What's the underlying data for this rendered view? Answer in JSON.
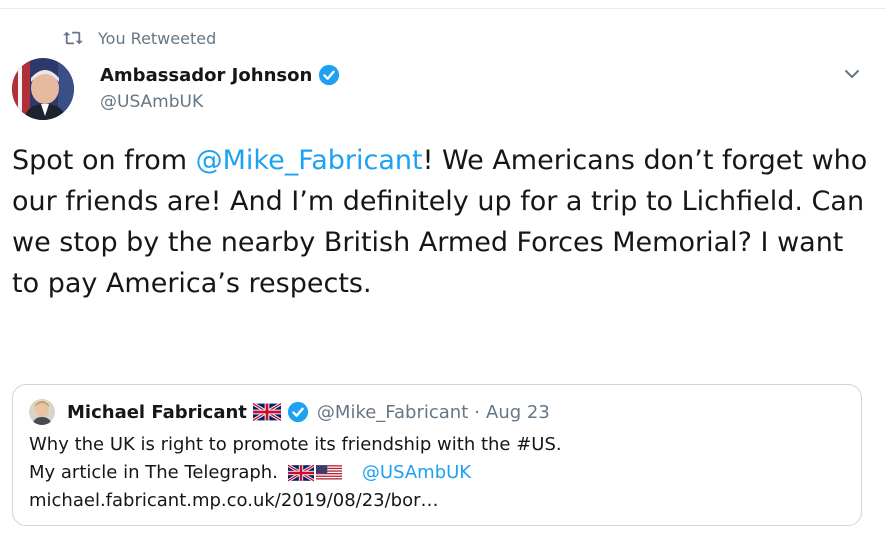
{
  "retweet": {
    "label": "You Retweeted"
  },
  "author": {
    "name": "Ambassador Johnson",
    "handle": "@USAmbUK"
  },
  "tweet": {
    "prefix": "Spot on from ",
    "mention": "@Mike_Fabricant",
    "suffix": "! We Americans don’t forget who our friends are! And I’m definitely up for a trip to Lichfield. Can we stop by the nearby British Armed Forces Memorial? I want to pay America’s respects."
  },
  "quote": {
    "name": "Michael Fabricant",
    "handle": "@Mike_Fabricant",
    "separator": "·",
    "date": "Aug 23",
    "line1": "Why the UK is right to promote its friendship with the #US.",
    "line2": "My article in The Telegraph.",
    "mention": "@USAmbUK",
    "link": "michael.fabricant.mp.co.uk/2019/08/23/bor…"
  },
  "icons": {
    "retweet": "retweet-icon",
    "verified": "verified-badge-icon",
    "more": "chevron-down-icon",
    "uk_flag": "uk-flag-icon",
    "us_flag": "us-flag-icon"
  },
  "colors": {
    "link": "#1da1f2",
    "muted": "#657786",
    "text": "#14171a",
    "border": "#ccd6dd"
  }
}
